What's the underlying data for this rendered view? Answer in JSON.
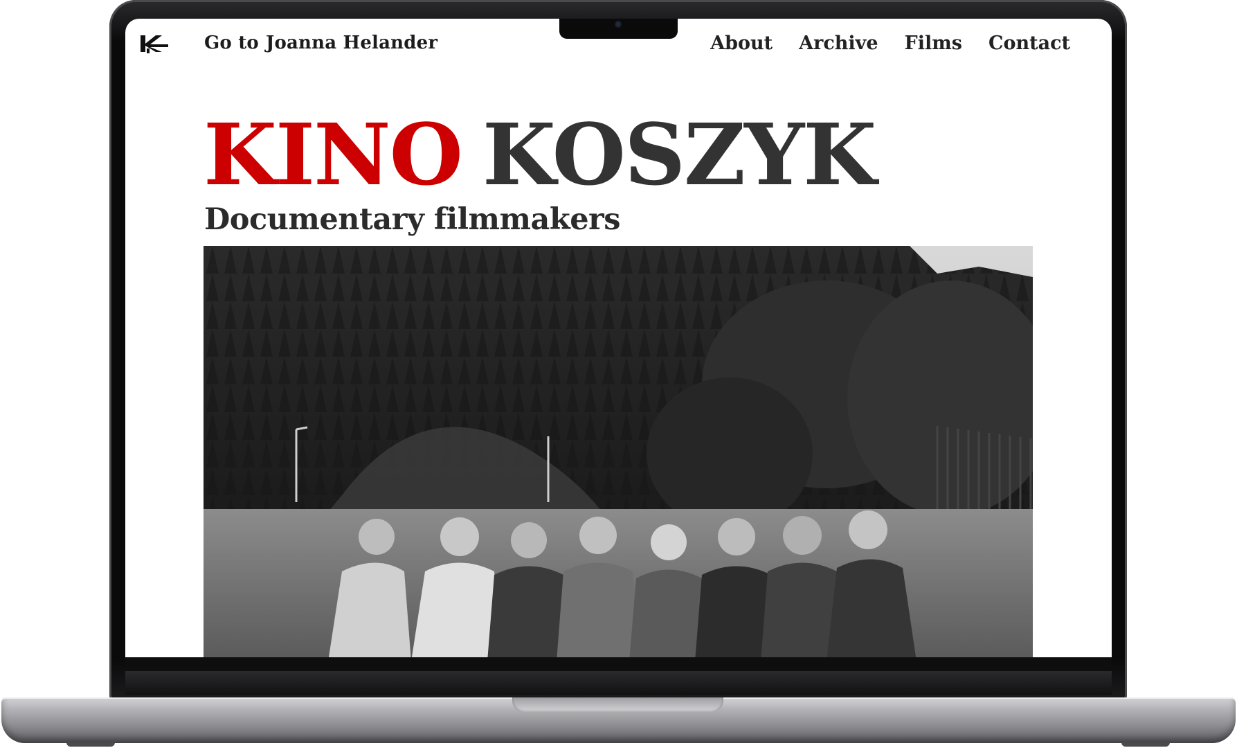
{
  "site": {
    "logo_icon": "kino-koszyk-k-logo",
    "goto": {
      "prefix": "Go to",
      "name": "Joanna Helander"
    },
    "nav": [
      {
        "label": "About"
      },
      {
        "label": "Archive"
      },
      {
        "label": "Films"
      },
      {
        "label": "Contact"
      }
    ],
    "hero": {
      "title_part1": "KINO",
      "title_part2": "KOSZYK",
      "subtitle": "Documentary filmmakers"
    }
  },
  "colors": {
    "accent_red": "#cc0000",
    "title_dark": "#333333",
    "text": "#1c1c1c",
    "background": "#ffffff"
  }
}
